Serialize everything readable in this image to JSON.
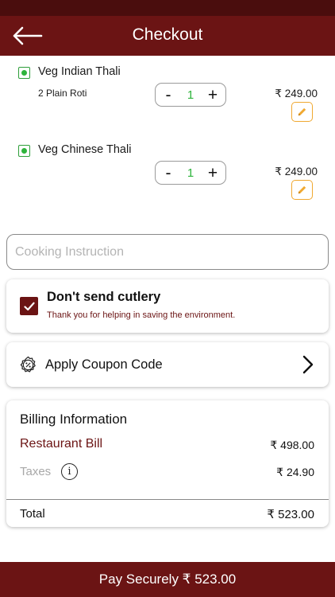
{
  "header": {
    "title": "Checkout",
    "back_icon": "arrow-left-icon"
  },
  "items": [
    {
      "name": "Veg Indian Thali",
      "description": "2 Plain Roti",
      "quantity": "1",
      "price": "₹ 249.00",
      "minus": "-",
      "plus": "+"
    },
    {
      "name": "Veg Chinese Thali",
      "description": "",
      "quantity": "1",
      "price": "₹ 249.00",
      "minus": "-",
      "plus": "+"
    }
  ],
  "cooking_instruction": {
    "placeholder": "Cooking Instruction",
    "value": ""
  },
  "cutlery": {
    "title": "Don't send cutlery",
    "subtitle": "Thank you for helping in saving the environment.",
    "checked": true
  },
  "coupon": {
    "label": "Apply Coupon Code",
    "icon": "coupon-percent-icon"
  },
  "billing": {
    "title": "Billing Information",
    "restaurant_bill_label": "Restaurant Bill",
    "restaurant_bill_value": "₹ 498.00",
    "taxes_label": "Taxes",
    "taxes_info_symbol": "i",
    "taxes_value": "₹ 24.90",
    "total_label": "Total",
    "total_value": "₹ 523.00"
  },
  "pay_button": {
    "label": "Pay Securely ₹ 523.00"
  },
  "colors": {
    "primary": "#6b1414",
    "status_bar": "#4a0d0d",
    "veg_green": "#2eb43c",
    "edit_orange": "#f0a830",
    "muted_text": "#a8a8a8"
  }
}
